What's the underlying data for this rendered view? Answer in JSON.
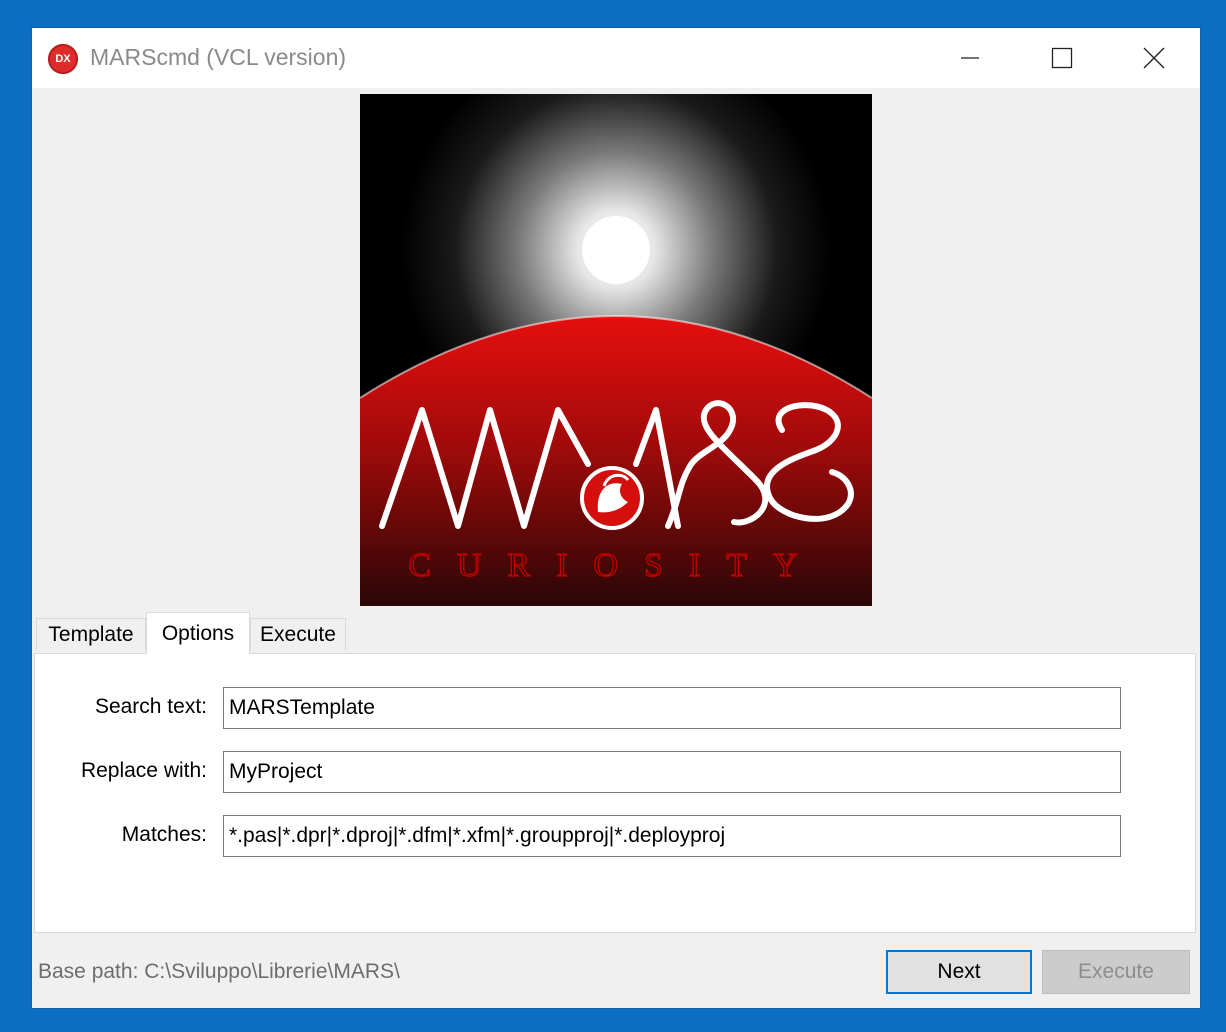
{
  "window": {
    "title": "MARScmd (VCL version)",
    "app_icon_text": "DX",
    "app_icon_name": "delphi-dx-icon",
    "controls": [
      "minimize-icon",
      "maximize-icon",
      "close-icon"
    ]
  },
  "logo": {
    "title": "MARS",
    "subtitle": "CURIOSITY",
    "colors": {
      "sky": "#000000",
      "planet": "#d50e0e",
      "text": "#ffffff",
      "subtitle": "#c30000"
    }
  },
  "tabs": [
    {
      "label": "Template",
      "active": false
    },
    {
      "label": "Options",
      "active": true
    },
    {
      "label": "Execute",
      "active": false
    }
  ],
  "options": {
    "search_label": "Search text:",
    "search_value": "MARSTemplate",
    "replace_label": "Replace with:",
    "replace_value": "MyProject",
    "matches_label": "Matches:",
    "matches_value": "*.pas|*.dpr|*.dproj|*.dfm|*.xfm|*.groupproj|*.deployproj"
  },
  "status": {
    "base_path": "Base path: C:\\Sviluppo\\Librerie\\MARS\\"
  },
  "buttons": {
    "next": "Next",
    "execute": "Execute",
    "execute_enabled": false
  },
  "colors": {
    "accent": "#0078d7",
    "desktop": "#0a6fc2",
    "window_bg": "#f0f0f0"
  }
}
